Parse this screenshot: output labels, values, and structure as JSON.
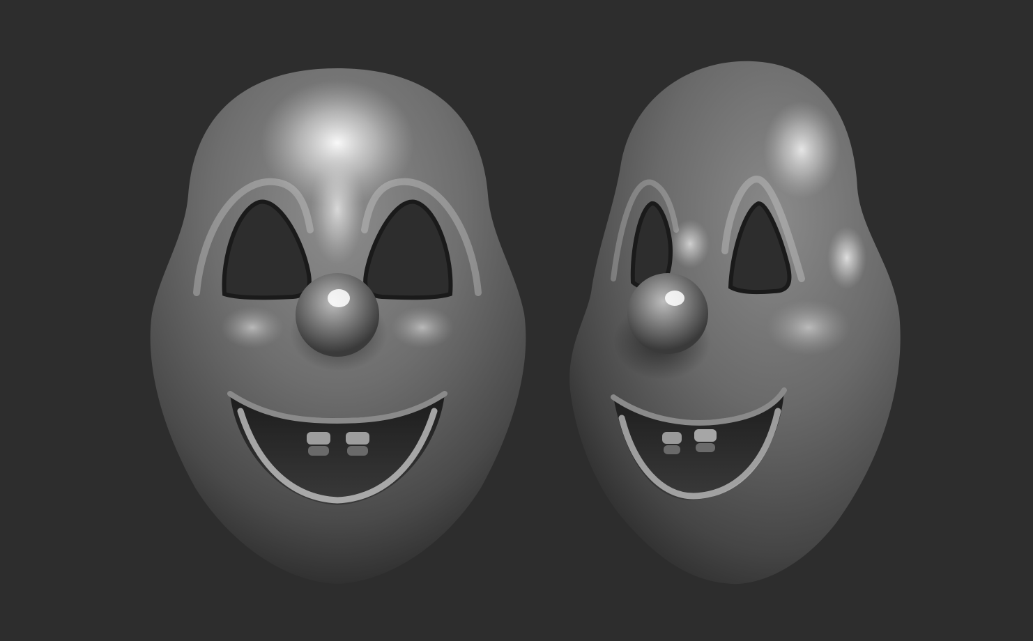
{
  "scene": {
    "background_color": "#2d2d2d",
    "material_color": "#6f6f6f",
    "highlight_color": "#f2f2f2",
    "shadow_color": "#0f0f0f",
    "objects": [
      {
        "name": "clown-mask-front",
        "view": "front",
        "expression": "smiling"
      },
      {
        "name": "clown-mask-three-quarter",
        "view": "three-quarter",
        "expression": "smiling"
      }
    ]
  }
}
